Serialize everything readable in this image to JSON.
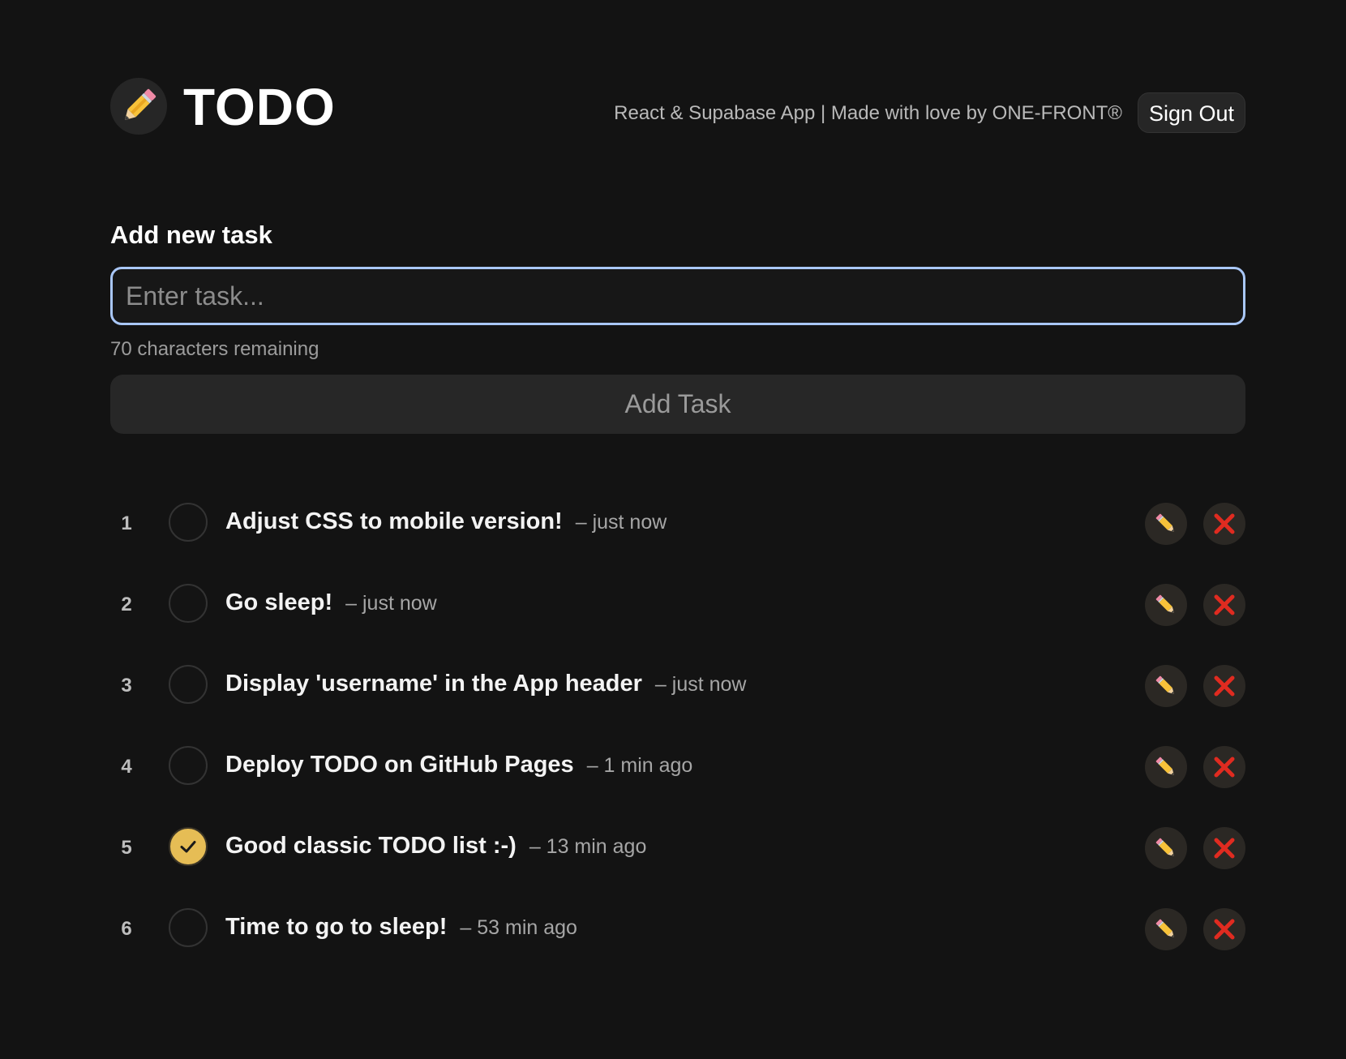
{
  "header": {
    "title": "TODO",
    "tagline": "React & Supabase App | Made with love by ONE-FRONT®",
    "sign_out_label": "Sign Out",
    "logo_icon": "pencil-icon"
  },
  "form": {
    "heading": "Add new task",
    "input_placeholder": "Enter task...",
    "input_value": "",
    "chars_remaining": "70 characters remaining",
    "add_button_label": "Add Task"
  },
  "tasks": [
    {
      "number": "1",
      "title": "Adjust CSS to mobile version!",
      "time": "– just now",
      "completed": false
    },
    {
      "number": "2",
      "title": "Go sleep!",
      "time": "– just now",
      "completed": false
    },
    {
      "number": "3",
      "title": "Display 'username' in the App header",
      "time": "– just now",
      "completed": false
    },
    {
      "number": "4",
      "title": "Deploy TODO on GitHub Pages",
      "time": "– 1 min ago",
      "completed": false
    },
    {
      "number": "5",
      "title": "Good classic TODO list :-)",
      "time": "– 13 min ago",
      "completed": true
    },
    {
      "number": "6",
      "title": "Time to go to sleep!",
      "time": "– 53 min ago",
      "completed": false
    }
  ],
  "icons": {
    "edit": "pencil-icon",
    "delete": "red-cross-icon",
    "check": "checkmark-icon"
  },
  "colors": {
    "background": "#131313",
    "input_focus_border": "#a9c7f7",
    "completed_check": "#e6bd55",
    "delete_icon": "#e02b20"
  }
}
